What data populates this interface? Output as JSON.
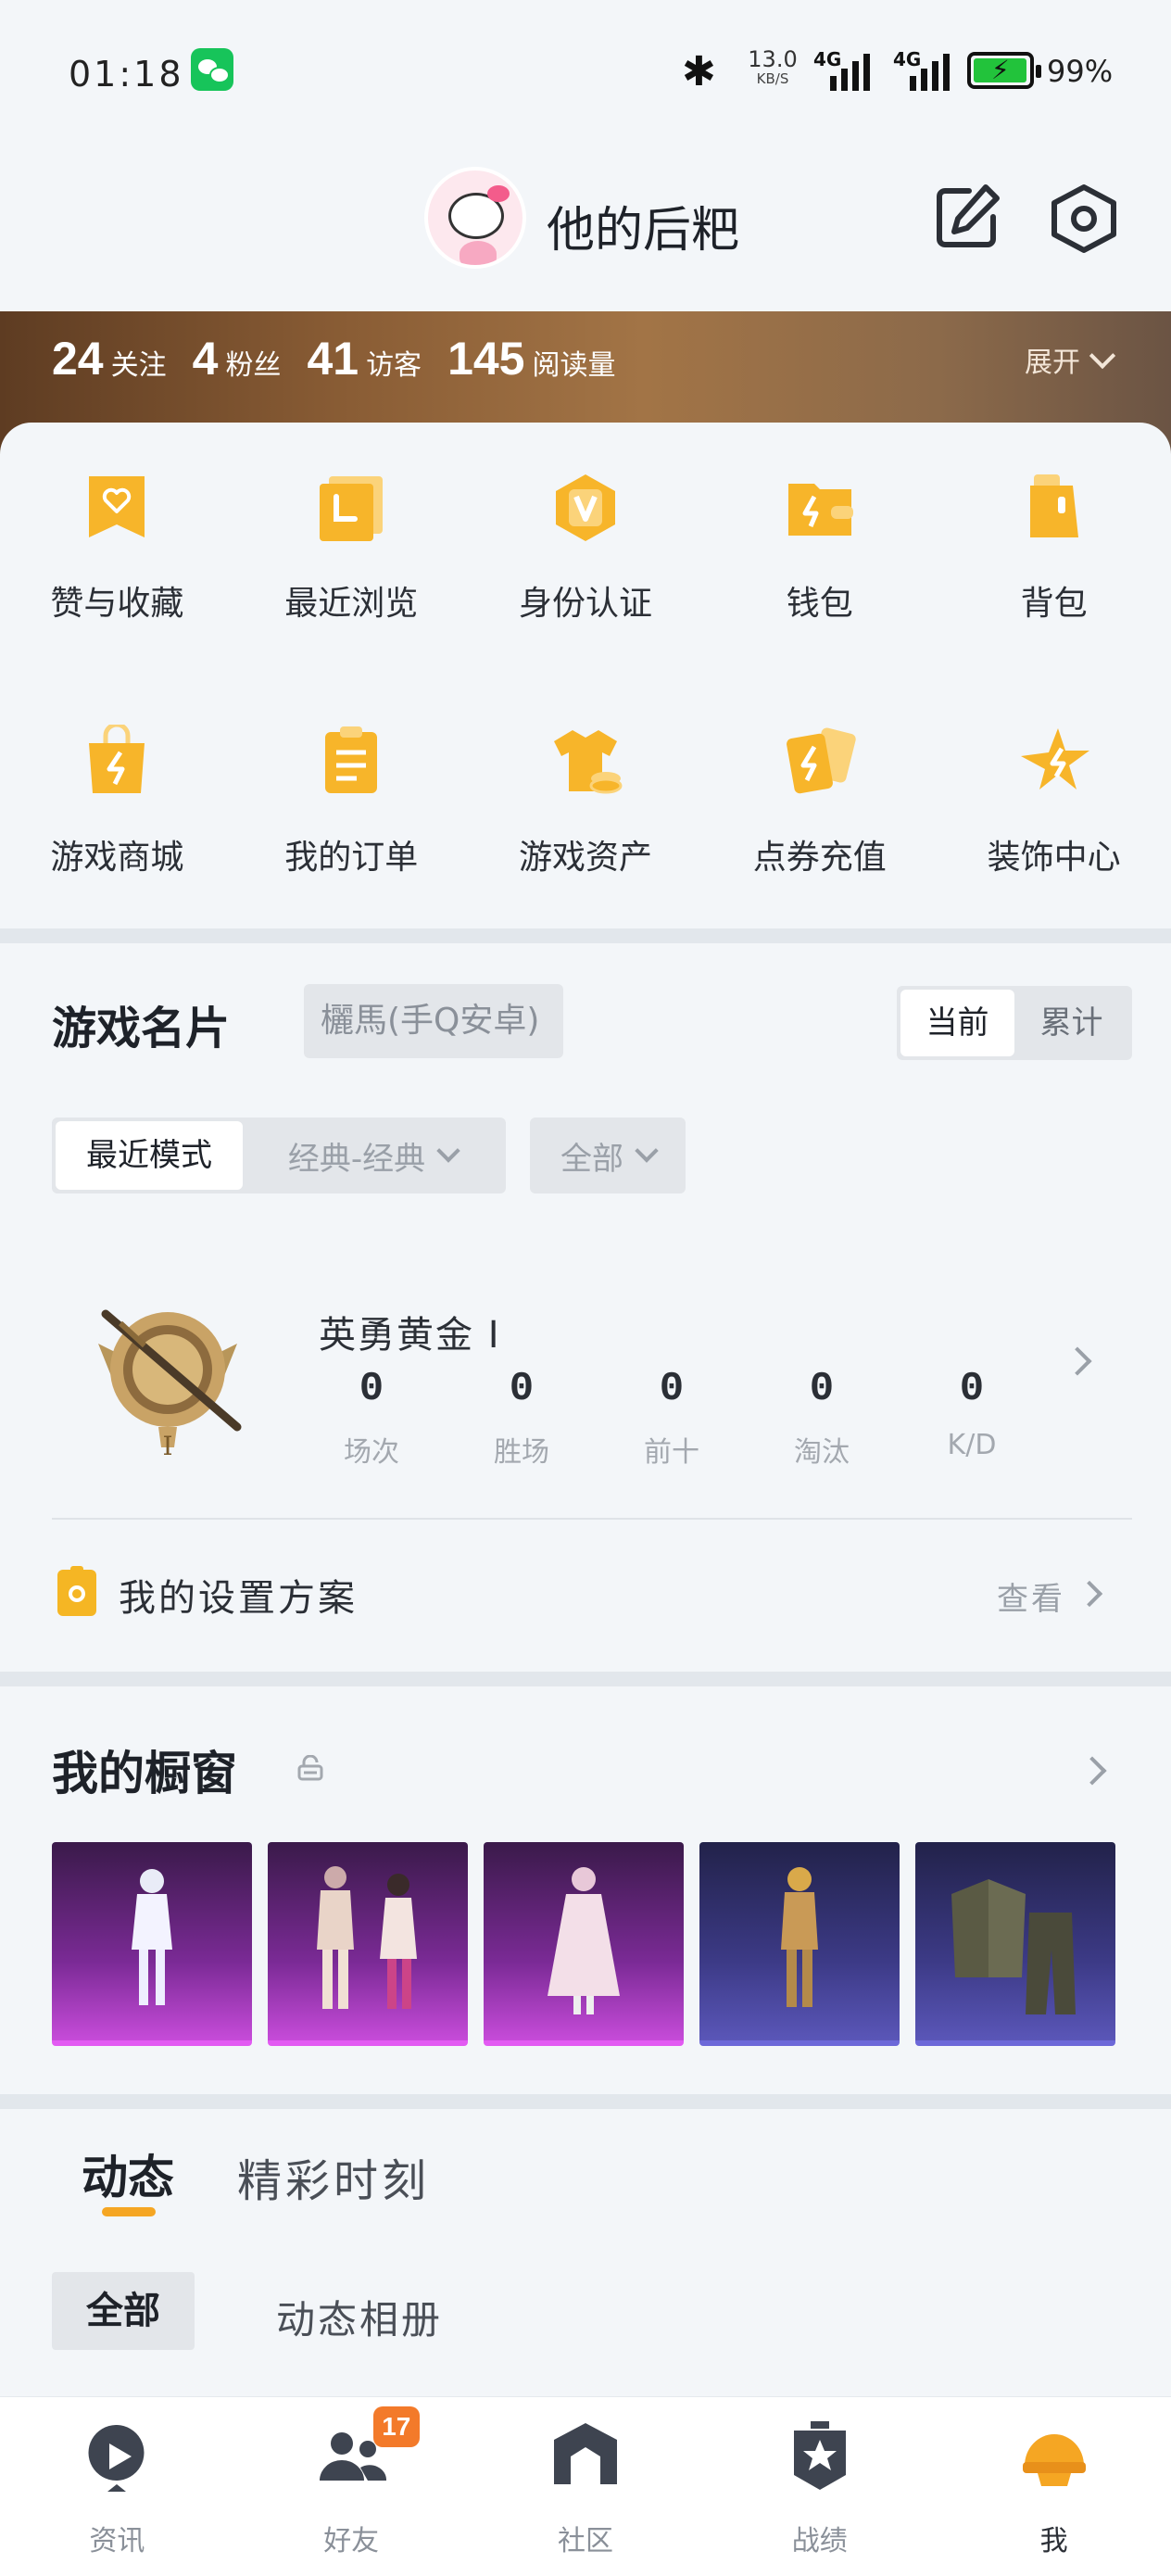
{
  "status_bar": {
    "time": "01:18",
    "net_speed_value": "13.0",
    "net_speed_unit": "KB/S",
    "signal1_label": "4G",
    "signal2_label": "4G",
    "battery_pct": "99%",
    "battery_level": 0.99
  },
  "header": {
    "username": "他的后粑"
  },
  "stats": [
    {
      "num": "24",
      "label": "关注"
    },
    {
      "num": "4",
      "label": "粉丝"
    },
    {
      "num": "41",
      "label": "访客"
    },
    {
      "num": "145",
      "label": "阅读量"
    }
  ],
  "expand_label": "展开",
  "menu": [
    {
      "label": "赞与收藏",
      "icon": "bookmark-heart-icon"
    },
    {
      "label": "最近浏览",
      "icon": "recent-folder-icon"
    },
    {
      "label": "身份认证",
      "icon": "verified-v-icon"
    },
    {
      "label": "钱包",
      "icon": "wallet-icon"
    },
    {
      "label": "背包",
      "icon": "backpack-icon"
    },
    {
      "label": "游戏商城",
      "icon": "shop-bag-icon"
    },
    {
      "label": "我的订单",
      "icon": "order-list-icon"
    },
    {
      "label": "游戏资产",
      "icon": "game-assets-icon"
    },
    {
      "label": "点券充值",
      "icon": "coupon-recharge-icon"
    },
    {
      "label": "装饰中心",
      "icon": "decoration-star-icon"
    }
  ],
  "game_card": {
    "title": "游戏名片",
    "nickname": "欐馬(手Q安卓)",
    "seg_current": "当前",
    "seg_total": "累计",
    "mode_recent": "最近模式",
    "mode_classic": "经典-经典",
    "mode_all": "全部",
    "rank_name": "英勇黄金 I",
    "rank_stats": [
      {
        "value": "0",
        "label": "场次"
      },
      {
        "value": "0",
        "label": "胜场"
      },
      {
        "value": "0",
        "label": "前十"
      },
      {
        "value": "0",
        "label": "淘汰"
      },
      {
        "value": "0",
        "label": "K/D"
      }
    ],
    "config_label": "我的设置方案",
    "config_view": "查看"
  },
  "showcase": {
    "title": "我的橱窗",
    "items": [
      "purple",
      "purple",
      "purple",
      "blue",
      "blue"
    ]
  },
  "feed": {
    "tab_dynamic": "动态",
    "tab_moments": "精彩时刻",
    "sub_all": "全部",
    "sub_album": "动态相册"
  },
  "bottom_nav": [
    {
      "label": "资讯",
      "icon": "news-play-icon"
    },
    {
      "label": "好友",
      "icon": "friends-icon",
      "badge": "17"
    },
    {
      "label": "社区",
      "icon": "community-icon"
    },
    {
      "label": "战绩",
      "icon": "record-badge-icon"
    },
    {
      "label": "我",
      "icon": "me-helmet-icon"
    }
  ],
  "colors": {
    "accent": "#f5a623",
    "menu_icon": "#f7b52a",
    "badge": "#f37a2a"
  }
}
